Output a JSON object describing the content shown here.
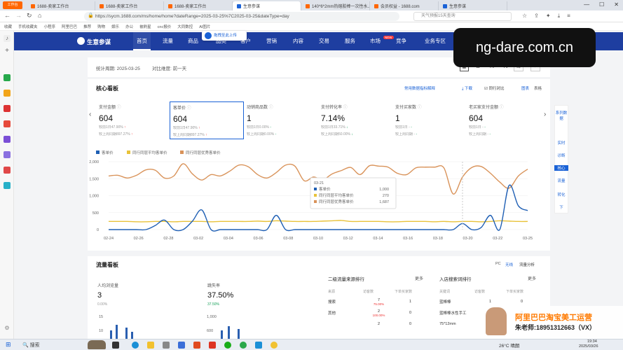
{
  "browser": {
    "tabs": [
      {
        "label": "1688-卖家工作台",
        "color": "#f60"
      },
      {
        "label": "1688-卖家工作台",
        "color": "#f60"
      },
      {
        "label": "1688-卖家工作台",
        "color": "#f60"
      },
      {
        "label": "生意参谋",
        "color": "#1a62d6"
      },
      {
        "label": "140*6*2mm热熔胶棒一次性水...",
        "color": "#f60"
      },
      {
        "label": "会员权益 - 1688.com",
        "color": "#f60"
      },
      {
        "label": "生意参谋",
        "color": "#1a62d6"
      }
    ],
    "url": "https://sycm.1688.com/ms/home/home?dateRange=2025-03-25%7C2025-03-25&dateType=day",
    "search_placeholder": "天气预报15天查询",
    "bookmarks": [
      "收藏",
      "手机收藏夹",
      "小程序",
      "阿里巴巴",
      "推荐",
      "购物",
      "娱乐",
      "办公",
      "被刷星",
      "cnc报价",
      "大同数控",
      "AI图片"
    ]
  },
  "app": {
    "logo": "生意参谋",
    "nav": [
      "首页",
      "流量",
      "商品",
      "品类",
      "客户",
      "营销",
      "内容",
      "交易",
      "服务",
      "市场",
      "竞争",
      "业务专区"
    ],
    "nav_badge": "NEW",
    "upload_tip": "拖拽至此上传"
  },
  "period": {
    "label": "统计周期: 2025-03-25",
    "compare": "对比维度: 前一天",
    "ranges": [
      "日",
      "周",
      "月"
    ]
  },
  "core": {
    "title": "核心看板",
    "faq": "常用数据指标解释",
    "download": "下载",
    "peer_compare": "同行对比",
    "chart_btn": "图表",
    "table_btn": "表格",
    "metrics": [
      {
        "label": "支付金额",
        "value": "604",
        "sub1": "较前1日47.90%",
        "sub1dir": "up",
        "sub2": "较上周同期897.27%",
        "sub2dir": "up"
      },
      {
        "label": "客单价",
        "value": "604",
        "sub1": "较前1日47.90%",
        "sub1dir": "up",
        "sub2": "较上周同期897.27%",
        "sub2dir": "up"
      },
      {
        "label": "动销商品数",
        "value": "1",
        "sub1": "较前1日0.00%",
        "sub1dir": "flat",
        "sub2": "较上周同期0.00%",
        "sub2dir": "flat"
      },
      {
        "label": "支付转化率",
        "value": "7.14%",
        "sub1": "较前1日33.71%",
        "sub1dir": "dn",
        "sub2": "较上周同期50.00%",
        "sub2dir": "dn"
      },
      {
        "label": "支付买家数",
        "value": "1",
        "sub1": "较前1日 -",
        "sub1dir": "flat",
        "sub2": "较上周同期 -",
        "sub2dir": "flat"
      },
      {
        "label": "老买家支付金额",
        "value": "604",
        "sub1": "较前1日 -",
        "sub1dir": "flat",
        "sub2": "较上周同期 -",
        "sub2dir": "flat"
      }
    ]
  },
  "side": [
    "系列数据",
    "实时",
    "诊断",
    "核心",
    "流量",
    "转化",
    "下"
  ],
  "chart_data": {
    "type": "line",
    "legend": [
      "客单价",
      "同行同层平均客单价",
      "同行同层优秀客单价"
    ],
    "x": [
      "02-24",
      "02-26",
      "02-28",
      "03-02",
      "03-04",
      "03-06",
      "03-08",
      "03-10",
      "03-12",
      "03-14",
      "03-16",
      "03-18",
      "03-20",
      "03-22",
      "03-25"
    ],
    "ylim": [
      0,
      2000
    ],
    "yticks": [
      "2,000",
      "1,500",
      "1,000",
      "500",
      "0"
    ],
    "colors": [
      "#1f5fb4",
      "#e8c23a",
      "#d9935a"
    ],
    "series": [
      {
        "name": "客单价",
        "values": [
          0,
          0,
          0,
          0,
          0,
          120,
          280,
          0,
          0,
          250,
          580,
          0,
          0,
          0,
          0,
          0,
          0,
          0,
          420,
          0,
          0,
          0,
          0,
          0,
          0,
          0,
          0,
          0,
          0,
          0,
          0,
          0,
          0,
          0,
          0,
          0,
          0,
          0,
          180,
          0,
          60,
          420,
          0,
          1300,
          700,
          560
        ]
      },
      {
        "name": "同行同层平均客单价",
        "values": [
          240,
          240,
          240,
          230,
          230,
          240,
          240,
          230,
          240,
          240,
          240,
          230,
          240,
          240,
          240,
          240,
          250,
          240,
          260,
          250,
          240,
          240,
          240,
          250,
          260,
          270,
          240,
          240,
          240,
          240,
          230,
          230,
          240,
          240,
          240,
          230,
          240,
          230,
          240,
          240,
          230,
          240,
          260,
          250,
          240,
          240
        ]
      },
      {
        "name": "同行同层优秀客单价",
        "values": [
          1580,
          1600,
          1520,
          1600,
          1760,
          1750,
          1520,
          1580,
          1940,
          1640,
          1460,
          1620,
          1580,
          1720,
          1900,
          1850,
          1620,
          1520,
          1680,
          1900,
          1870,
          1440,
          1550,
          1470,
          1640,
          1740,
          1830,
          1620,
          1880,
          1870,
          1840,
          1660,
          1620,
          1820,
          1840,
          1840,
          1820,
          1050,
          1550,
          1830,
          1860,
          1660,
          1400,
          1220,
          1580,
          1780
        ]
      }
    ],
    "tooltip": {
      "date": "03-21",
      "rows": [
        [
          "客单价",
          "1,000"
        ],
        [
          "同行同层平均客单价",
          "270"
        ],
        [
          "同行同层优秀客单价",
          "1,687"
        ]
      ]
    }
  },
  "traffic": {
    "title": "流量看板",
    "pc": "PC",
    "wireless": "无线",
    "analysis": "流量分析",
    "m1_label": "人均浏览量",
    "m1_val": "3",
    "m1_sub": "0.00%",
    "m2_label": "跳失率",
    "m2_val": "37.50%",
    "m2_sub": "37.50%",
    "src_title": "二级流量来源排行",
    "kw_title": "入店搜索词排行",
    "more": "更多",
    "src_cols": [
      "来源",
      "访客数",
      "下单买家数"
    ],
    "kw_cols": [
      "关键词",
      "访客数",
      "下单买家数"
    ],
    "src_rows": [
      [
        "搜索",
        "7",
        "75.00%",
        "1"
      ],
      [
        "其他",
        "2",
        "100.00%",
        "0"
      ],
      [
        "",
        "2",
        "",
        "0"
      ]
    ],
    "kw_rows": [
      [
        "蓝棒棒",
        "1",
        "0"
      ],
      [
        "蓝棒棒水性手工",
        "1",
        "0"
      ],
      [
        "75*12mm",
        "1",
        "0"
      ]
    ],
    "mini_ticks": [
      "15",
      "1,000",
      "10",
      "600"
    ]
  },
  "overlay": {
    "watermark": "ng-dare.com.cn",
    "promo1": "阿里巴巴淘宝美工运营",
    "promo2": "朱老师:18951312663（VX）"
  },
  "taskbar": {
    "search": "搜索",
    "weather": "26°C 晴朗",
    "time": "19:34",
    "date": "2025/03/26"
  }
}
